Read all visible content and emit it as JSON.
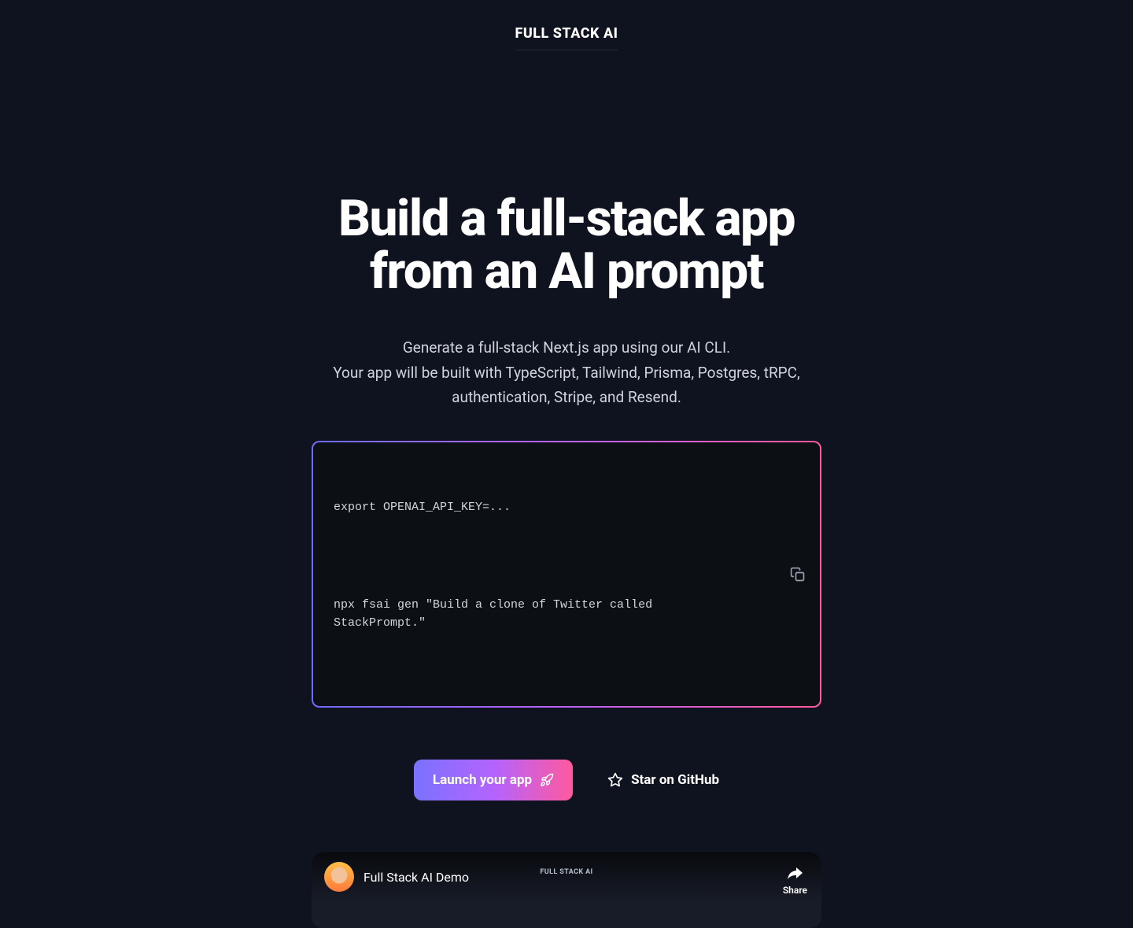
{
  "header": {
    "logo": "FULL STACK AI"
  },
  "hero": {
    "title_line1": "Build a full-stack app",
    "title_line2": "from an AI prompt",
    "subtitle_line1": "Generate a full-stack Next.js app using our AI CLI.",
    "subtitle_line2": "Your app will be built with TypeScript, Tailwind, Prisma, Postgres, tRPC, authentication, Stripe, and Resend."
  },
  "code": {
    "line1": "export OPENAI_API_KEY=...",
    "line2": "npx fsai gen \"Build a clone of Twitter called StackPrompt.\""
  },
  "buttons": {
    "launch": "Launch your app",
    "github": "Star on GitHub"
  },
  "video": {
    "title": "Full Stack AI Demo",
    "brand": "FULL STACK AI",
    "share": "Share"
  }
}
